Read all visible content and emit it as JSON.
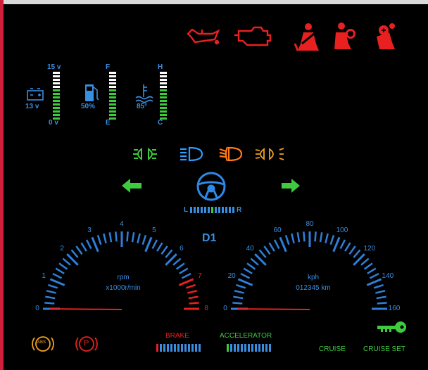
{
  "gauges_small": {
    "battery": {
      "top": "15 v",
      "value": "13 v",
      "bottom": "0 v"
    },
    "fuel": {
      "top": "F",
      "value": "50%",
      "bottom": "E"
    },
    "temp": {
      "top": "H",
      "value": "85°",
      "bottom": "C"
    }
  },
  "gear": "D1",
  "steering": {
    "left": "L",
    "right": "R"
  },
  "tach": {
    "unit": "rpm",
    "scale": "x1000r/min",
    "ticks": [
      "0",
      "1",
      "2",
      "3",
      "4",
      "5",
      "6",
      "7",
      "8"
    ],
    "max": 8,
    "value": 0
  },
  "speedo": {
    "unit": "kph",
    "odometer": "012345 km",
    "ticks": [
      "0",
      "20",
      "40",
      "60",
      "80",
      "100",
      "120",
      "140",
      "160"
    ],
    "max": 160,
    "value": 0
  },
  "pedals": {
    "brake": "BRAKE",
    "accelerator": "ACCELERATOR"
  },
  "cruise": {
    "cruise": "CRUISE",
    "cruise_set": "CRUISE SET"
  },
  "warnings": {
    "abs": "ABS",
    "parking": "P"
  },
  "colors": {
    "blue": "#3a8ee0",
    "red": "#e82020",
    "green": "#3ecb3e",
    "amber": "#f0a020",
    "orange": "#ff7a1a",
    "white": "#ffffff"
  }
}
